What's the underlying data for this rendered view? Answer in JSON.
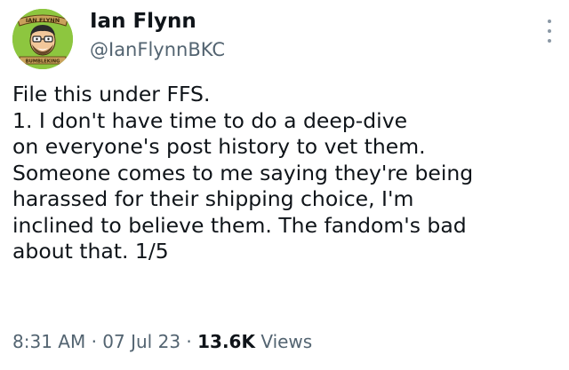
{
  "author": {
    "display_name": "Ian Flynn",
    "handle": "@IanFlynnBKC",
    "avatar_icon": "profile-avatar-cartoon",
    "avatar_text_top": "IAN FLYNN",
    "avatar_text_bottom": "BUMBLEKING"
  },
  "tweet": {
    "lines": [
      "File this under FFS.",
      "1. I don't have time to do a deep-dive",
      "on everyone's post history to vet them.",
      "Someone comes to me saying they're being",
      "harassed for their shipping choice, I'm",
      "inclined to believe them. The fandom's bad",
      "about that. 1/5"
    ]
  },
  "meta": {
    "time": "8:31 AM",
    "separator": "·",
    "date": "07 Jul 23",
    "views_count": "13.6K",
    "views_label": "Views"
  },
  "colors": {
    "text": "#0f1419",
    "secondary": "#536471",
    "avatar_bg": "#7bc043"
  }
}
